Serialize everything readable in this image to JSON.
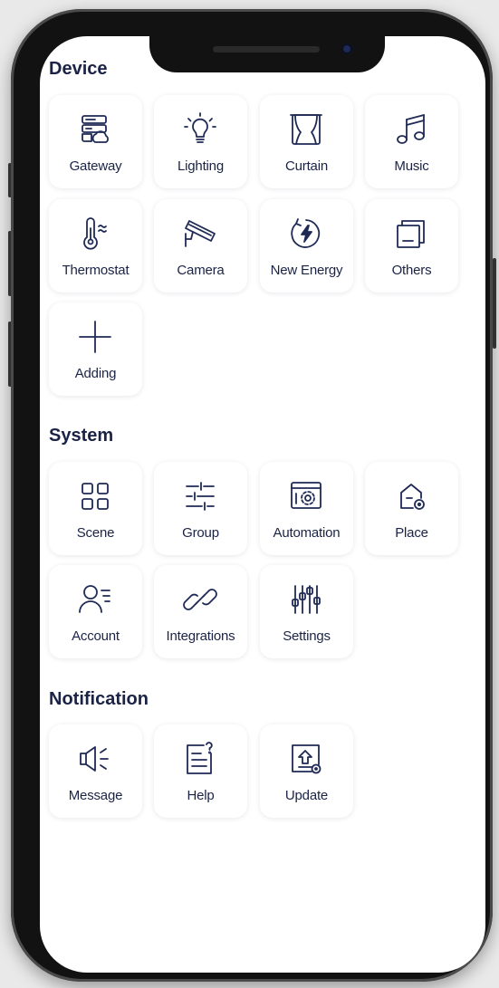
{
  "sections": {
    "device": {
      "title": "Device",
      "items": [
        {
          "label": "Gateway",
          "icon": "gateway-icon"
        },
        {
          "label": "Lighting",
          "icon": "lightbulb-icon"
        },
        {
          "label": "Curtain",
          "icon": "curtain-icon"
        },
        {
          "label": "Music",
          "icon": "music-note-icon"
        },
        {
          "label": "Thermostat",
          "icon": "thermometer-icon"
        },
        {
          "label": "Camera",
          "icon": "security-camera-icon"
        },
        {
          "label": "New Energy",
          "icon": "energy-bolt-icon"
        },
        {
          "label": "Others",
          "icon": "stacked-squares-icon"
        },
        {
          "label": "Adding",
          "icon": "plus-icon"
        }
      ]
    },
    "system": {
      "title": "System",
      "items": [
        {
          "label": "Scene",
          "icon": "grid-icon"
        },
        {
          "label": "Group",
          "icon": "sliders-horizontal-icon"
        },
        {
          "label": "Automation",
          "icon": "automation-gear-icon"
        },
        {
          "label": "Place",
          "icon": "home-location-icon"
        },
        {
          "label": "Account",
          "icon": "user-list-icon"
        },
        {
          "label": "Integrations",
          "icon": "link-icon"
        },
        {
          "label": "Settings",
          "icon": "sliders-vertical-icon"
        }
      ]
    },
    "notification": {
      "title": "Notification",
      "items": [
        {
          "label": "Message",
          "icon": "speaker-icon"
        },
        {
          "label": "Help",
          "icon": "help-document-icon"
        },
        {
          "label": "Update",
          "icon": "upload-icon"
        }
      ]
    }
  },
  "colors": {
    "text": "#1a2346",
    "icon_stroke": "#1f2a56",
    "tile_bg": "#ffffff"
  }
}
